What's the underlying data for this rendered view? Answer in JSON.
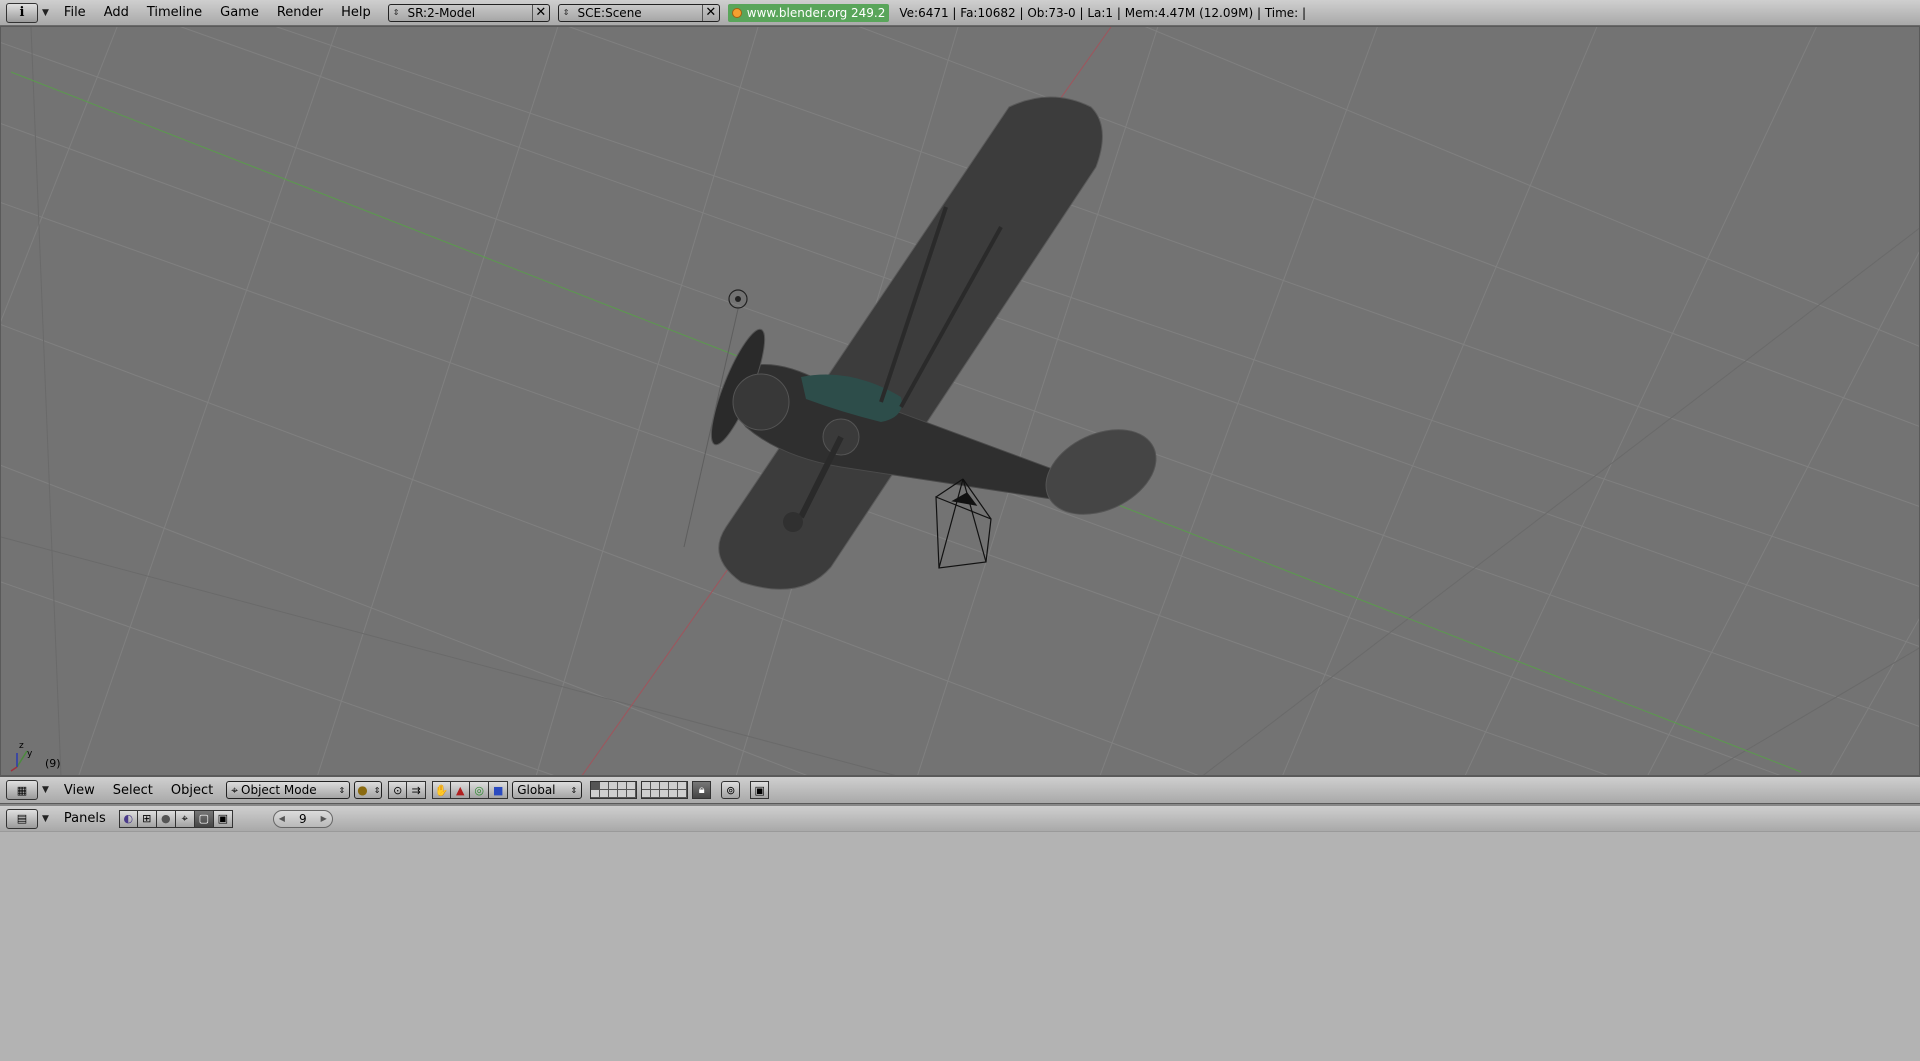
{
  "topbar": {
    "menus": [
      "File",
      "Add",
      "Timeline",
      "Game",
      "Render",
      "Help"
    ],
    "screen": {
      "value": "SR:2-Model",
      "icon": "screen-browse-icon"
    },
    "scene": {
      "value": "SCE:Scene",
      "icon": "scene-browse-icon"
    },
    "website": "www.blender.org 249.2",
    "stats": "Ve:6471 | Fa:10682 | Ob:73-0 | La:1  | Mem:4.47M (12.09M)  | Time: |"
  },
  "viewport": {
    "frame_indicator": "(9)",
    "axis_labels": {
      "z": "z",
      "y": "y"
    }
  },
  "view3d_header": {
    "menus": [
      "View",
      "Select",
      "Object"
    ],
    "mode": "Object Mode",
    "orientation": "Global"
  },
  "buttons_header": {
    "panels_label": "Panels",
    "frame_value": "9"
  },
  "colors": {
    "viewport_bg": "#737373",
    "grid": "#828282",
    "x_axis": "#a0545c",
    "y_axis": "#5b9a4d",
    "website_bg": "#59a55a"
  }
}
